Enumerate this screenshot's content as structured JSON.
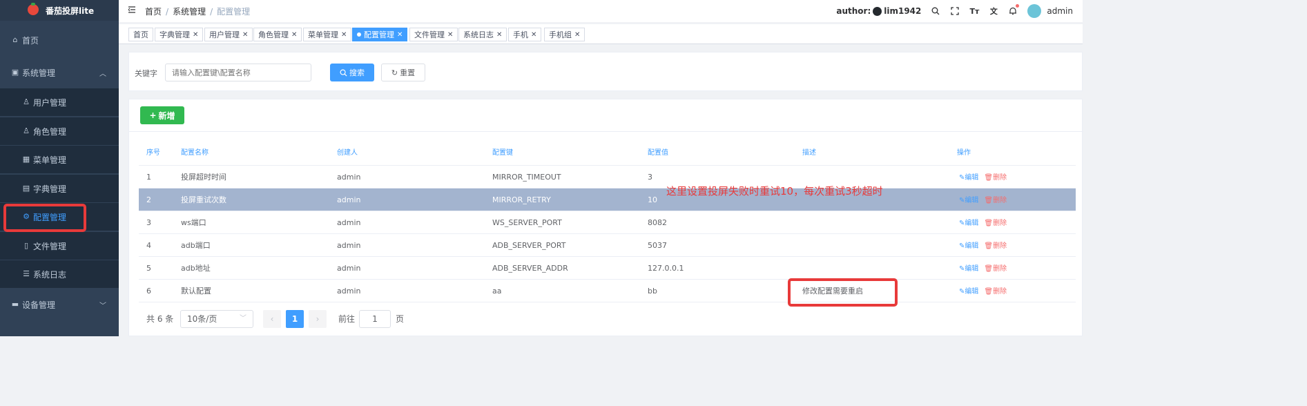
{
  "app": {
    "logo_text": "番茄投屏lite"
  },
  "sidebar": {
    "items": [
      {
        "label": "首页",
        "icon": "home-icon"
      },
      {
        "label": "系统管理",
        "icon": "monitor-icon"
      },
      {
        "label": "用户管理",
        "icon": "user-icon"
      },
      {
        "label": "角色管理",
        "icon": "peoples-icon"
      },
      {
        "label": "菜单管理",
        "icon": "tree-table-icon"
      },
      {
        "label": "字典管理",
        "icon": "dict-icon"
      },
      {
        "label": "配置管理",
        "icon": "gear-icon"
      },
      {
        "label": "文件管理",
        "icon": "file-icon"
      },
      {
        "label": "系统日志",
        "icon": "log-icon"
      },
      {
        "label": "设备管理",
        "icon": "device-icon"
      }
    ]
  },
  "header": {
    "breadcrumb": [
      "首页",
      "系统管理",
      "配置管理"
    ],
    "author_label": "author:",
    "author_name": "lim1942",
    "username": "admin"
  },
  "tags": [
    {
      "label": "首页",
      "closable": false,
      "active": false
    },
    {
      "label": "字典管理",
      "closable": true,
      "active": false
    },
    {
      "label": "用户管理",
      "closable": true,
      "active": false
    },
    {
      "label": "角色管理",
      "closable": true,
      "active": false
    },
    {
      "label": "菜单管理",
      "closable": true,
      "active": false
    },
    {
      "label": "配置管理",
      "closable": true,
      "active": true
    },
    {
      "label": "文件管理",
      "closable": true,
      "active": false
    },
    {
      "label": "系统日志",
      "closable": true,
      "active": false
    },
    {
      "label": "手机",
      "closable": true,
      "active": false
    },
    {
      "label": "手机组",
      "closable": true,
      "active": false
    }
  ],
  "search": {
    "label": "关键字",
    "placeholder": "请输入配置键\\配置名称",
    "search_button": "搜索",
    "reset_button": "重置"
  },
  "toolbar": {
    "add_button": "新增"
  },
  "table": {
    "columns": [
      "序号",
      "配置名称",
      "创建人",
      "配置键",
      "配置值",
      "描述",
      "操作"
    ],
    "rows": [
      {
        "no": "1",
        "name": "投屏超时时间",
        "creator": "admin",
        "key": "MIRROR_TIMEOUT",
        "value": "3",
        "desc": ""
      },
      {
        "no": "2",
        "name": "投屏重试次数",
        "creator": "admin",
        "key": "MIRROR_RETRY",
        "value": "10",
        "desc": ""
      },
      {
        "no": "3",
        "name": "ws端口",
        "creator": "admin",
        "key": "WS_SERVER_PORT",
        "value": "8082",
        "desc": ""
      },
      {
        "no": "4",
        "name": "adb端口",
        "creator": "admin",
        "key": "ADB_SERVER_PORT",
        "value": "5037",
        "desc": ""
      },
      {
        "no": "5",
        "name": "adb地址",
        "creator": "admin",
        "key": "ADB_SERVER_ADDR",
        "value": "127.0.0.1",
        "desc": ""
      },
      {
        "no": "6",
        "name": "默认配置",
        "creator": "admin",
        "key": "aa",
        "value": "bb",
        "desc": "修改配置需要重启"
      }
    ],
    "edit_label": "编辑",
    "delete_label": "删除"
  },
  "annotation": "这里设置投屏失败时重试10，每次重试3秒超时",
  "pagination": {
    "total_text": "共 6 条",
    "page_size": "10条/页",
    "current_page": "1",
    "goto_label": "前往",
    "goto_value": "1",
    "page_suffix": "页"
  },
  "colors": {
    "sidebar_bg": "#304156",
    "primary": "#409eff",
    "success": "#31b950",
    "danger": "#f56c6c",
    "annotation": "#e83a3a",
    "highlight_row": "#a3b4cf"
  }
}
